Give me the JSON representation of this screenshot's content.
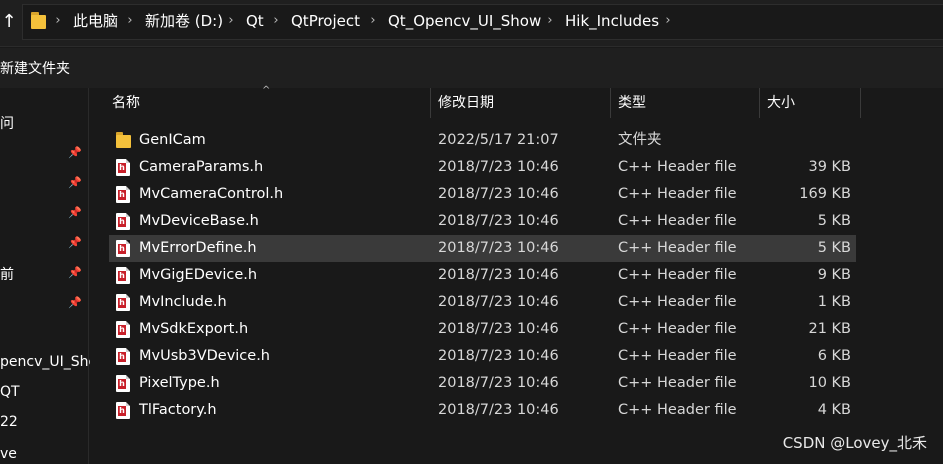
{
  "address_bar": {
    "up_glyph": "↑",
    "folder_icon": "folder-icon",
    "separator_glyph": "›",
    "crumbs": [
      "此电脑",
      "新加卷 (D:)",
      "Qt",
      "QtProject",
      "Qt_Opencv_UI_Show",
      "Hik_Includes"
    ]
  },
  "command_bar": {
    "new_folder_label": "新建文件夹"
  },
  "nav_pane": {
    "items": [
      "问",
      "",
      "",
      "",
      "",
      "前",
      "",
      "pencv_UI_Sho",
      "QT",
      "22",
      "ve"
    ],
    "pin_glyph": "📌"
  },
  "columns": {
    "name": "名称",
    "date": "修改日期",
    "type": "类型",
    "size": "大小",
    "sort_glyph": "^"
  },
  "files": [
    {
      "name": "GenICam",
      "date": "2022/5/17 21:07",
      "type": "文件夹",
      "size": "",
      "icon": "folder-icon"
    },
    {
      "name": "CameraParams.h",
      "date": "2018/7/23 10:46",
      "type": "C++ Header file",
      "size": "39 KB",
      "icon": "header-file-icon"
    },
    {
      "name": "MvCameraControl.h",
      "date": "2018/7/23 10:46",
      "type": "C++ Header file",
      "size": "169 KB",
      "icon": "header-file-icon"
    },
    {
      "name": "MvDeviceBase.h",
      "date": "2018/7/23 10:46",
      "type": "C++ Header file",
      "size": "5 KB",
      "icon": "header-file-icon"
    },
    {
      "name": "MvErrorDefine.h",
      "date": "2018/7/23 10:46",
      "type": "C++ Header file",
      "size": "5 KB",
      "icon": "header-file-icon"
    },
    {
      "name": "MvGigEDevice.h",
      "date": "2018/7/23 10:46",
      "type": "C++ Header file",
      "size": "9 KB",
      "icon": "header-file-icon"
    },
    {
      "name": "MvInclude.h",
      "date": "2018/7/23 10:46",
      "type": "C++ Header file",
      "size": "1 KB",
      "icon": "header-file-icon"
    },
    {
      "name": "MvSdkExport.h",
      "date": "2018/7/23 10:46",
      "type": "C++ Header file",
      "size": "21 KB",
      "icon": "header-file-icon"
    },
    {
      "name": "MvUsb3VDevice.h",
      "date": "2018/7/23 10:46",
      "type": "C++ Header file",
      "size": "6 KB",
      "icon": "header-file-icon"
    },
    {
      "name": "PixelType.h",
      "date": "2018/7/23 10:46",
      "type": "C++ Header file",
      "size": "10 KB",
      "icon": "header-file-icon"
    },
    {
      "name": "TlFactory.h",
      "date": "2018/7/23 10:46",
      "type": "C++ Header file",
      "size": "4 KB",
      "icon": "header-file-icon"
    }
  ],
  "header_icon_letter": "h",
  "selected_file": "MvErrorDefine.h",
  "watermark": "CSDN @Lovey_北禾",
  "colors": {
    "background": "#191919",
    "selected_row": "#3a3a3a",
    "folder": "#f4c13b",
    "header_icon_accent": "#c8202a"
  }
}
